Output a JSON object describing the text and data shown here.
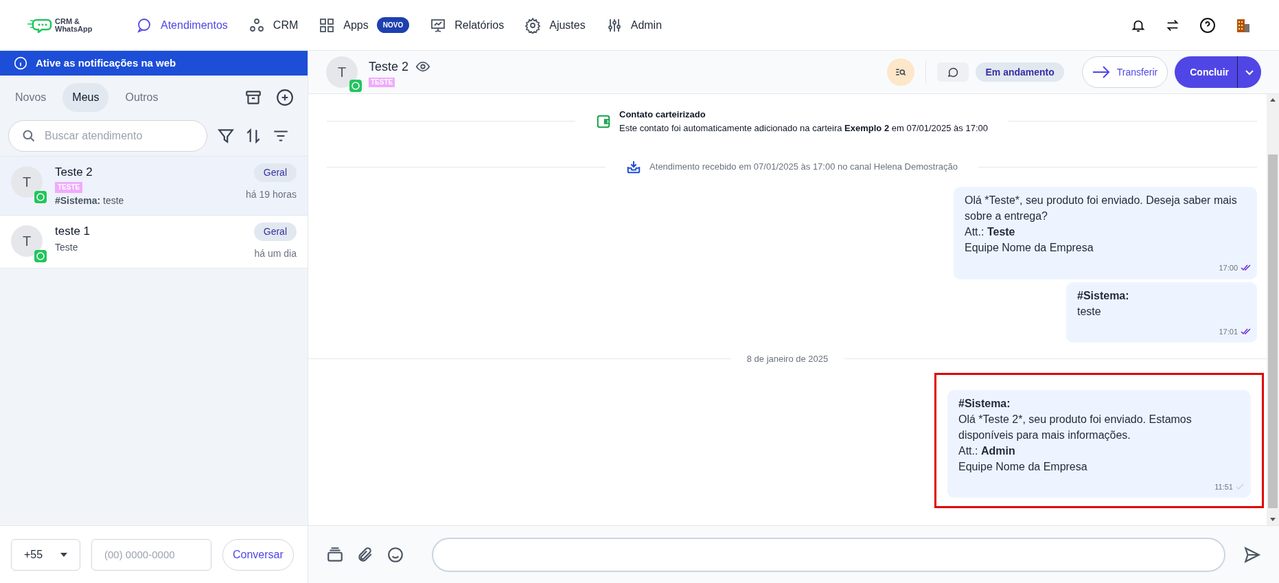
{
  "nav": {
    "logo_lines": [
      "CRM &",
      "WhatsApp"
    ],
    "items": [
      {
        "label": "Atendimentos",
        "selected": true,
        "kind": "chat"
      },
      {
        "label": "CRM",
        "selected": false,
        "kind": "nodes"
      },
      {
        "label": "Apps",
        "selected": false,
        "kind": "grid",
        "badge": "NOVO"
      },
      {
        "label": "Relatórios",
        "selected": false,
        "kind": "chart"
      },
      {
        "label": "Ajustes",
        "selected": false,
        "kind": "gear"
      },
      {
        "label": "Admin",
        "selected": false,
        "kind": "sliders"
      }
    ]
  },
  "notification_banner": "Ative as notificações na web",
  "tabs": [
    {
      "label": "Novos",
      "selected": false
    },
    {
      "label": "Meus",
      "selected": true
    },
    {
      "label": "Outros",
      "selected": false
    }
  ],
  "search": {
    "placeholder": "Buscar atendimento"
  },
  "conversations": [
    {
      "avatar": "T",
      "name": "Teste 2",
      "tag": "TESTE",
      "preview": "**#Sistema:** teste",
      "queue": "Geral",
      "time": "há 19 horas",
      "selected": true
    },
    {
      "avatar": "T",
      "name": "teste 1",
      "preview": "Teste",
      "queue": "Geral",
      "time": "há um dia",
      "selected": false
    }
  ],
  "new_chat": {
    "country_code": "+55",
    "phone_placeholder": "(00) 0000-0000",
    "button": "Conversar"
  },
  "chat": {
    "avatar": "T",
    "name": "Teste 2",
    "tag": "TESTE",
    "status": "Em andamento",
    "transfer": "Transferir",
    "conclude": "Concluir"
  },
  "timeline": [
    {
      "kind": "wallet_event",
      "title": "Contato carteirizado",
      "text": "Este contato foi automaticamente adicionado na carteira **Exemplo 2** em 07/01/2025 às 17:00"
    },
    {
      "kind": "inbox_event",
      "text": "Atendimento recebido em 07/01/2025 às 17:00 no canal Helena Demostração"
    },
    {
      "kind": "message",
      "body": "Olá *Teste*, seu produto foi enviado. Deseja saber mais sobre a entrega?",
      "signature_label": "Att.:",
      "signature_name": "Teste",
      "team": "Equipe Nome da Empresa",
      "time": "17:00",
      "read": true,
      "highlighted": false
    },
    {
      "kind": "message",
      "sender": "#Sistema:",
      "body": "teste",
      "time": "17:01",
      "read": true,
      "highlighted": false
    },
    {
      "kind": "date",
      "text": "8 de janeiro de 2025"
    },
    {
      "kind": "message",
      "sender": "#Sistema:",
      "body": "Olá *Teste 2*, seu produto foi enviado. Estamos disponíveis para mais informações.",
      "signature_label": "Att.:",
      "signature_name": "Admin",
      "team": "Equipe Nome da Empresa",
      "time": "11:51",
      "read": false,
      "highlighted": true
    }
  ]
}
